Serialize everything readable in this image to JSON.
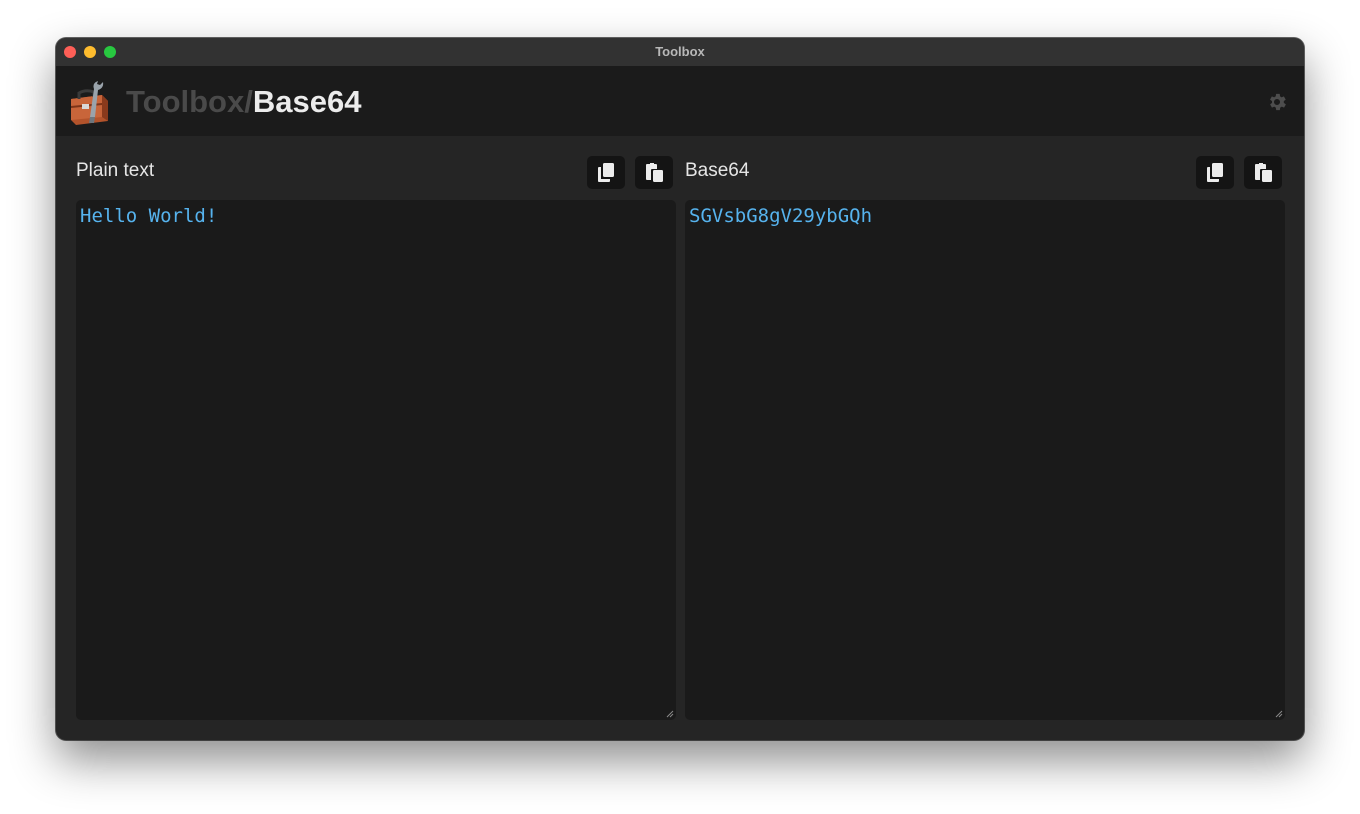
{
  "window": {
    "title": "Toolbox"
  },
  "header": {
    "breadcrumb_parent": "Toolbox",
    "breadcrumb_separator": "/",
    "breadcrumb_current": "Base64",
    "settings_icon": "gear-icon"
  },
  "panes": {
    "left": {
      "label": "Plain text",
      "value": "Hello World!",
      "copy_icon": "copy-icon",
      "paste_icon": "paste-icon"
    },
    "right": {
      "label": "Base64",
      "value": "SGVsbG8gV29ybGQh",
      "copy_icon": "copy-icon",
      "paste_icon": "paste-icon"
    }
  },
  "colors": {
    "accent_text": "#56b3ee",
    "window_bg": "#252525",
    "header_bg": "#1b1b1b",
    "editor_bg": "#1a1a1a"
  }
}
